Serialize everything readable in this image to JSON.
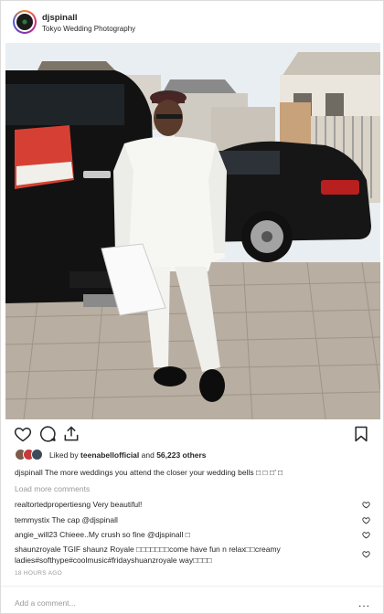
{
  "post": {
    "username": "djspinall",
    "location": "Tokyo Wedding Photography"
  },
  "likes": {
    "prefix": "Liked by ",
    "user": "teenabellofficial",
    "middle": " and ",
    "count": "56,223 others"
  },
  "caption": {
    "username": "djspinall",
    "text": " The more weddings you attend the closer your wedding bells □ □ □’ □"
  },
  "load_more": "Load more comments",
  "comments": [
    {
      "username": "realtortedpropertiesng",
      "text": " Very beautiful!"
    },
    {
      "username": "temmystix",
      "text": " The cap @djspinall"
    },
    {
      "username": "angie_will23",
      "text": " Chieee..My crush so fine @djspinall □"
    },
    {
      "username": "shaunzroyale",
      "text": " TGIF shaunz Royale □□□□□□□come have fun n relax□□creamy ladies#softhype#coolmusic#fridayshuanzroyale way□□□□"
    }
  ],
  "timestamp": "18 HOURS AGO",
  "add_comment_placeholder": "Add a comment...",
  "more_options": "...",
  "icons": {
    "like": "heart-icon",
    "comment": "comment-icon",
    "share": "share-icon",
    "save": "bookmark-icon",
    "comment_like": "heart-icon"
  },
  "colors": {
    "text": "#262626",
    "muted": "#999999",
    "border": "#dbdbdb"
  }
}
